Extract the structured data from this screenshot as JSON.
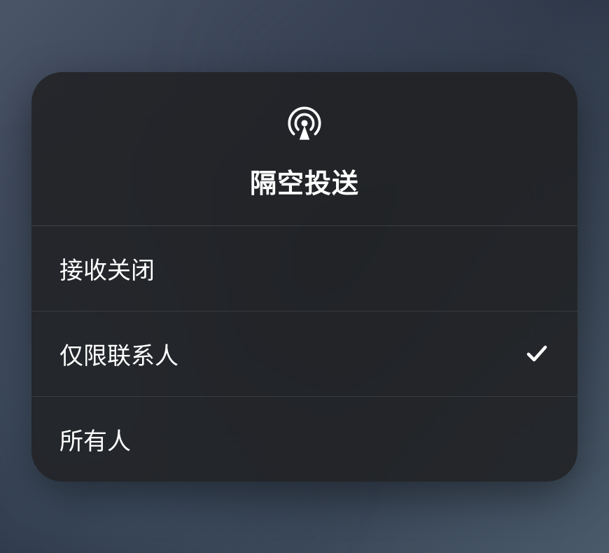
{
  "panel": {
    "title": "隔空投送",
    "iconName": "airdrop-icon"
  },
  "options": [
    {
      "label": "接收关闭",
      "selected": false
    },
    {
      "label": "仅限联系人",
      "selected": true
    },
    {
      "label": "所有人",
      "selected": false
    }
  ]
}
